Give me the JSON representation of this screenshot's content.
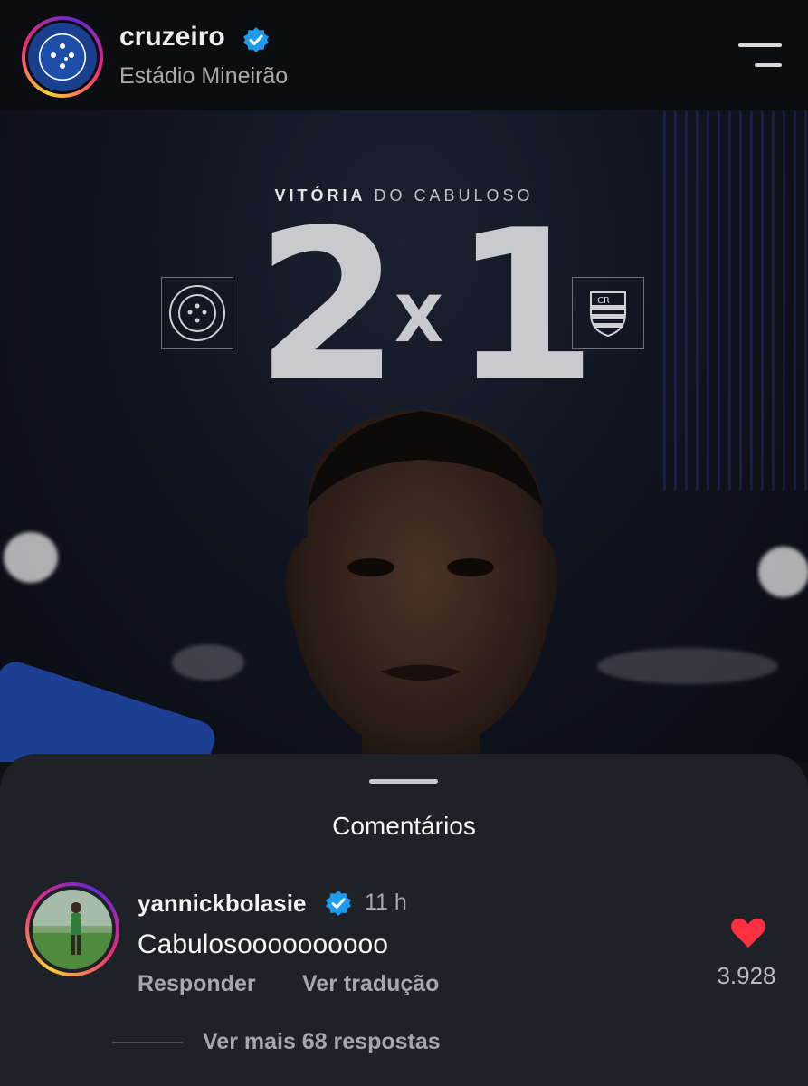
{
  "header": {
    "username": "cruzeiro",
    "location": "Estádio Mineirão"
  },
  "post": {
    "headline_bold": "VITÓRIA",
    "headline_rest": "DO CABULOSO",
    "home_score": "2",
    "separator": "X",
    "away_score": "1"
  },
  "comments": {
    "title": "Comentários",
    "items": [
      {
        "username": "yannickbolasie",
        "time": "11 h",
        "text": "Cabulosoooooooooo",
        "reply_label": "Responder",
        "translate_label": "Ver tradução",
        "likes": "3.928",
        "more_replies": "Ver mais 68 respostas"
      }
    ]
  },
  "colors": {
    "verified": "#1d9bf0",
    "heart": "#ff3040",
    "sheet": "#1e2126"
  }
}
